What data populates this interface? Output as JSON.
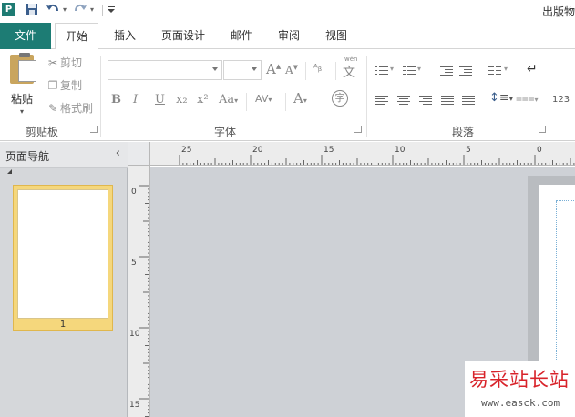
{
  "titlebar": {
    "app_icon_letter": "P",
    "qat": {
      "save_icon": "save-icon",
      "undo_icon": "undo-icon",
      "redo_icon": "redo-icon",
      "customize_icon": "customize-icon"
    },
    "title": "出版物"
  },
  "tabs": [
    {
      "label": "文件"
    },
    {
      "label": "开始"
    },
    {
      "label": "插入"
    },
    {
      "label": "页面设计"
    },
    {
      "label": "邮件"
    },
    {
      "label": "审阅"
    },
    {
      "label": "视图"
    }
  ],
  "ribbon": {
    "clipboard": {
      "label": "剪贴板",
      "paste": "粘贴",
      "cut": "剪切",
      "copy": "复制",
      "format_painter": "格式刷"
    },
    "font": {
      "label": "字体",
      "font_name": "",
      "font_size": "",
      "bold": "B",
      "italic": "I",
      "underline": "U",
      "subscript": "x₂",
      "superscript": "x²",
      "change_case": "Aa",
      "char_spacing": "AV",
      "font_color": "A",
      "grow": "A",
      "shrink": "A",
      "enclose": "字",
      "phonetic": "wén"
    },
    "paragraph": {
      "label": "段落",
      "number": "123"
    }
  },
  "nav_pane": {
    "title": "页面导航",
    "pages": [
      {
        "number": "1"
      }
    ]
  },
  "ruler": {
    "h_labels": [
      "25",
      "20",
      "15",
      "10",
      "5",
      "0"
    ],
    "v_labels": [
      "0",
      "5",
      "10",
      "15"
    ]
  },
  "watermark": {
    "text": "易采站长站",
    "url": "www.easck.com"
  },
  "colors": {
    "file_tab": "#1d7c74",
    "accent_blue": "#3b5e8c",
    "thumb_highlight": "#f5d77c",
    "workspace": "#ced1d6",
    "watermark_red": "#d8232a"
  }
}
